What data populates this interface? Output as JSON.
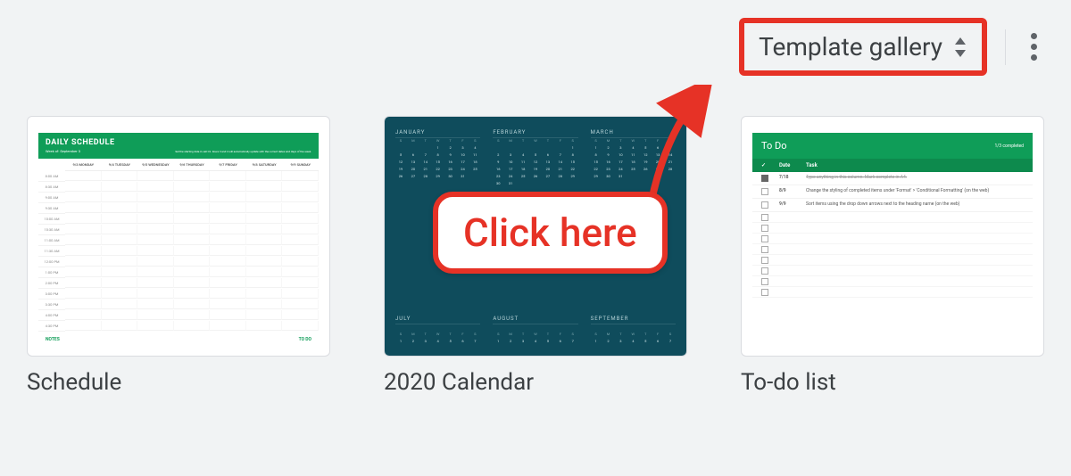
{
  "header": {
    "template_gallery_label": "Template gallery"
  },
  "templates": [
    {
      "label": "Schedule"
    },
    {
      "label": "2020 Calendar"
    },
    {
      "label": "To-do list"
    }
  ],
  "schedule_thumb": {
    "title": "DAILY SCHEDULE",
    "subtitle": "Week of: September 3",
    "note": "Set the starting date in cell C2. Rows 3 and 4 will automatically update with the correct dates and days of the week.",
    "days": [
      "9/3 MONDAY",
      "9/4 TUESDAY",
      "9/5 WEDNESDAY",
      "9/6 THURSDAY",
      "9/7 FRIDAY",
      "9/8 SATURDAY",
      "9/9 SUNDAY"
    ],
    "times": [
      "8:00 AM",
      "8:30 AM",
      "9:00 AM",
      "9:30 AM",
      "10:00 AM",
      "10:30 AM",
      "11:00 AM",
      "11:30 AM",
      "12:00 PM",
      "1:00 PM",
      "2:00 PM",
      "3:00 PM",
      "3:30 PM",
      "4:00 PM",
      "4:30 PM"
    ],
    "footer_left": "NOTES",
    "footer_right": "TO DO"
  },
  "calendar_thumb": {
    "months_top": [
      "JANUARY",
      "FEBRUARY",
      "MARCH"
    ],
    "months_bottom": [
      "JULY",
      "AUGUST",
      "SEPTEMBER"
    ],
    "day_headers": [
      "S",
      "M",
      "T",
      "W",
      "T",
      "F",
      "S"
    ]
  },
  "todo_thumb": {
    "title": "To Do",
    "counter": "1/3 completed",
    "col_check": "✓",
    "col_date": "Date",
    "col_task": "Task",
    "rows": [
      {
        "checked": true,
        "date": "7/18",
        "task": "Type anything in this column. Mark complete in A4."
      },
      {
        "checked": false,
        "date": "8/9",
        "task": "Change the styling of completed items under 'Format' > 'Conditional Formatting' (on the web)"
      },
      {
        "checked": false,
        "date": "9/9",
        "task": "Sort items using the drop down arrows next to the heading name (on the web)"
      }
    ]
  },
  "annotation": {
    "callout_text": "Click here"
  }
}
